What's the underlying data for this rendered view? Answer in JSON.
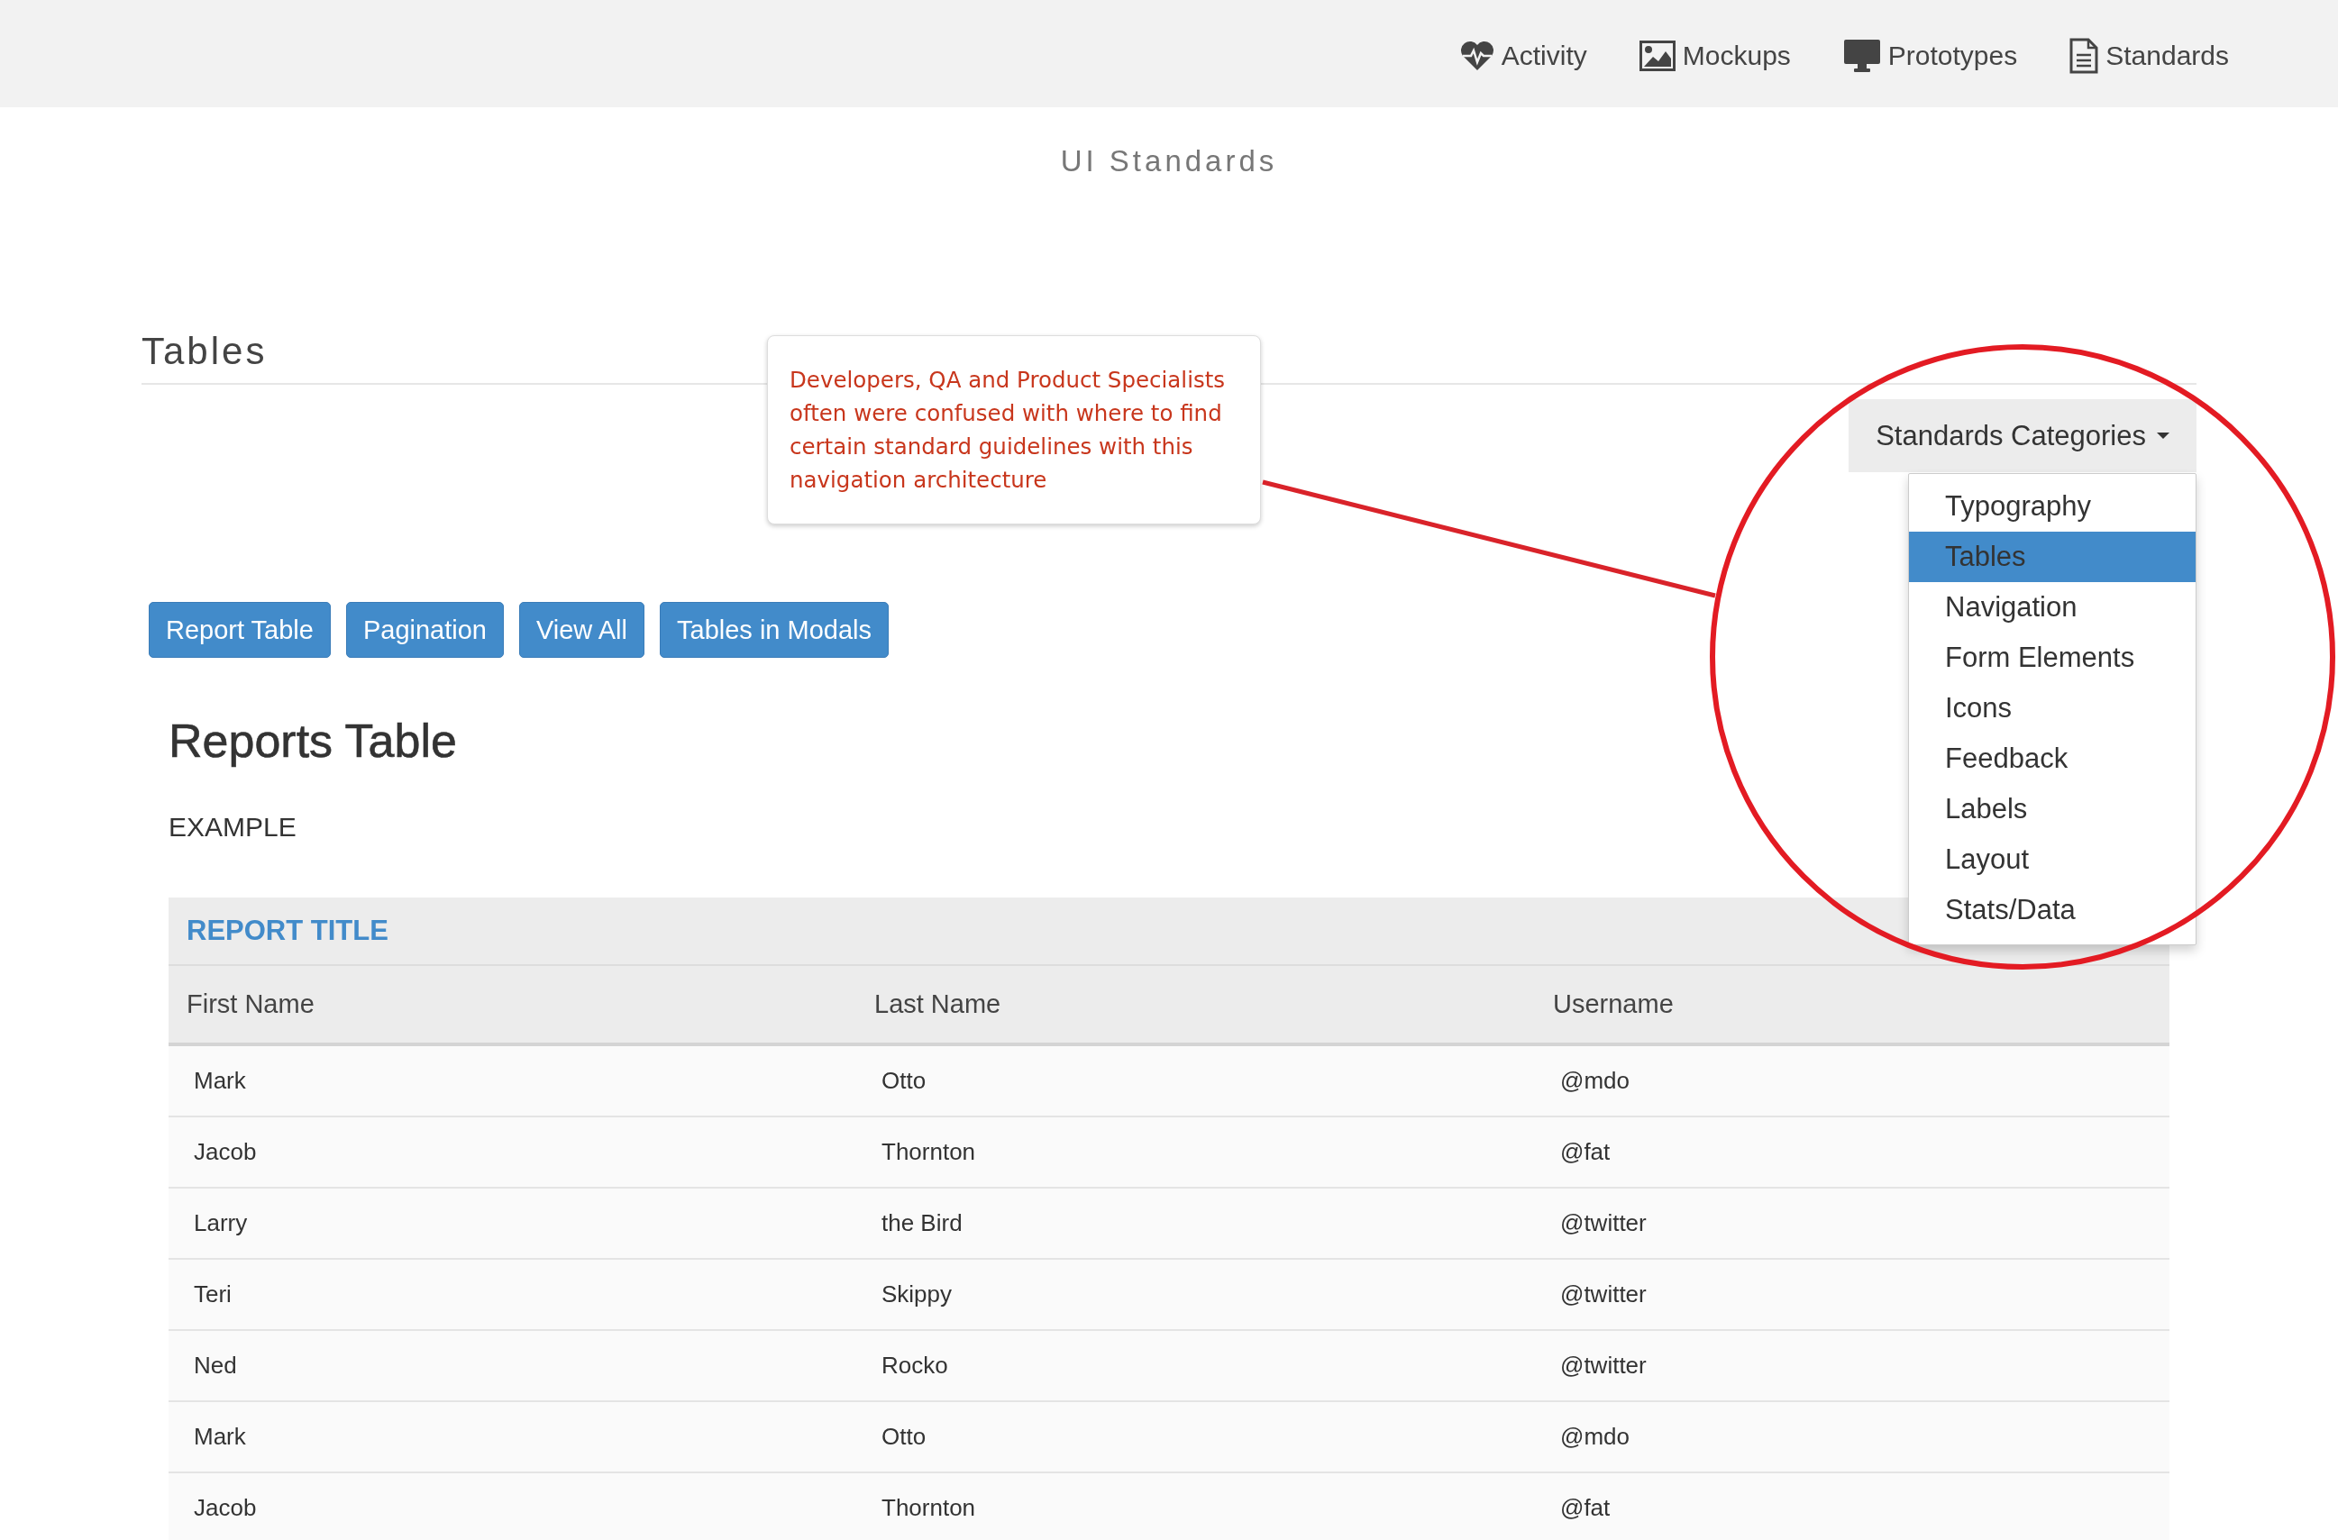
{
  "nav": {
    "items": [
      {
        "label": "Activity",
        "kind": "heartbeat"
      },
      {
        "label": "Mockups",
        "kind": "image"
      },
      {
        "label": "Prototypes",
        "kind": "monitor"
      },
      {
        "label": "Standards",
        "kind": "document"
      }
    ]
  },
  "site_title": "UI Standards",
  "section": {
    "title": "Tables"
  },
  "callout": {
    "text": "Developers, QA and Product Specialists often were confused with where to find certain standard guidelines with this navigation architecture"
  },
  "dropdown": {
    "label": "Standards Categories",
    "expanded": true,
    "items": [
      {
        "label": "Typography",
        "selected": false
      },
      {
        "label": "Tables",
        "selected": true
      },
      {
        "label": "Navigation",
        "selected": false
      },
      {
        "label": "Form Elements",
        "selected": false
      },
      {
        "label": "Icons",
        "selected": false
      },
      {
        "label": "Feedback",
        "selected": false
      },
      {
        "label": "Labels",
        "selected": false
      },
      {
        "label": "Layout",
        "selected": false
      },
      {
        "label": "Stats/Data",
        "selected": false
      }
    ]
  },
  "buttons": [
    "Report Table",
    "Pagination",
    "View All",
    "Tables in Modals"
  ],
  "report": {
    "heading": "Reports Table",
    "subheading": "EXAMPLE",
    "table": {
      "title": "REPORT TITLE",
      "columns": [
        "First Name",
        "Last Name",
        "Username"
      ],
      "rows": [
        [
          "Mark",
          "Otto",
          "@mdo"
        ],
        [
          "Jacob",
          "Thornton",
          "@fat"
        ],
        [
          "Larry",
          "the Bird",
          "@twitter"
        ],
        [
          "Teri",
          "Skippy",
          "@twitter"
        ],
        [
          "Ned",
          "Rocko",
          "@twitter"
        ],
        [
          "Mark",
          "Otto",
          "@mdo"
        ],
        [
          "Jacob",
          "Thornton",
          "@fat"
        ]
      ]
    }
  }
}
